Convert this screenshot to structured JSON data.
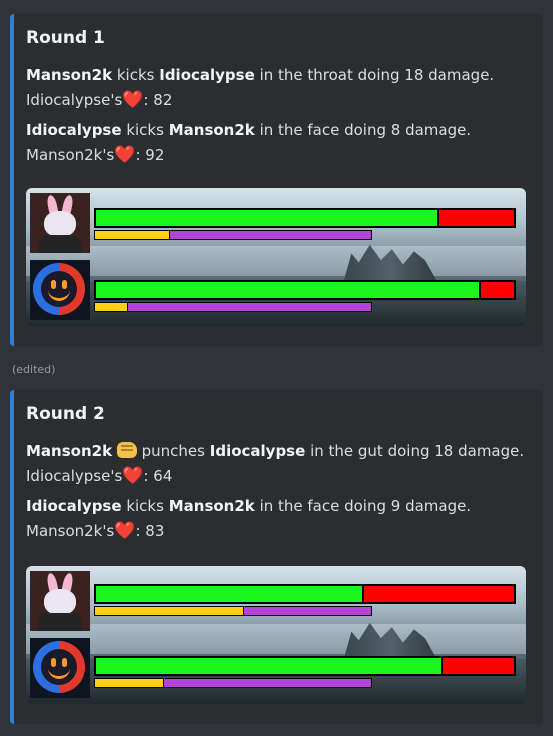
{
  "colors": {
    "embed_border": "#2f80d6",
    "hp_green": "#1df51d",
    "hp_red": "#ff0000",
    "energy_yellow": "#ffd012",
    "energy_purple": "#b643d3",
    "heart": "#f23f42"
  },
  "rounds": [
    {
      "title": "Round 1",
      "attack1": {
        "attacker": "Manson2k",
        "action": "kicks",
        "target": "Idiocalypse",
        "rest": "in the throat doing 18 damage."
      },
      "status1": {
        "label": "Idiocalypse's",
        "icon": "heart-icon",
        "heart": "❤️",
        "value": ": 82"
      },
      "attack2": {
        "attacker": "Idiocalypse",
        "action": "kicks",
        "target": "Manson2k",
        "rest": "in the face doing 8 damage."
      },
      "status2": {
        "label": "Manson2k's",
        "icon": "heart-icon",
        "heart": "❤️",
        "value": ": 92"
      },
      "fighters": [
        {
          "avatar": "rabbit-avatar",
          "hp_fraction": 0.82,
          "energy_fraction": 0.27
        },
        {
          "avatar": "smiley-avatar",
          "hp_fraction": 0.92,
          "energy_fraction": 0.12
        }
      ]
    },
    {
      "title": "Round 2",
      "attack1": {
        "attacker": "Manson2k",
        "action_icon": "fist-icon",
        "action": "punches",
        "target": "Idiocalypse",
        "rest": "in the gut doing 18 damage."
      },
      "status1": {
        "label": "Idiocalypse's",
        "icon": "heart-icon",
        "heart": "❤️",
        "value": ": 64"
      },
      "attack2": {
        "attacker": "Idiocalypse",
        "action": "kicks",
        "target": "Manson2k",
        "rest": "in the face doing 9 damage."
      },
      "status2": {
        "label": "Manson2k's",
        "icon": "heart-icon",
        "heart": "❤️",
        "value": ": 83"
      },
      "fighters": [
        {
          "avatar": "rabbit-avatar",
          "hp_fraction": 0.64,
          "energy_fraction": 0.54
        },
        {
          "avatar": "smiley-avatar",
          "hp_fraction": 0.83,
          "energy_fraction": 0.25
        }
      ]
    }
  ],
  "edited_label": "(edited)"
}
